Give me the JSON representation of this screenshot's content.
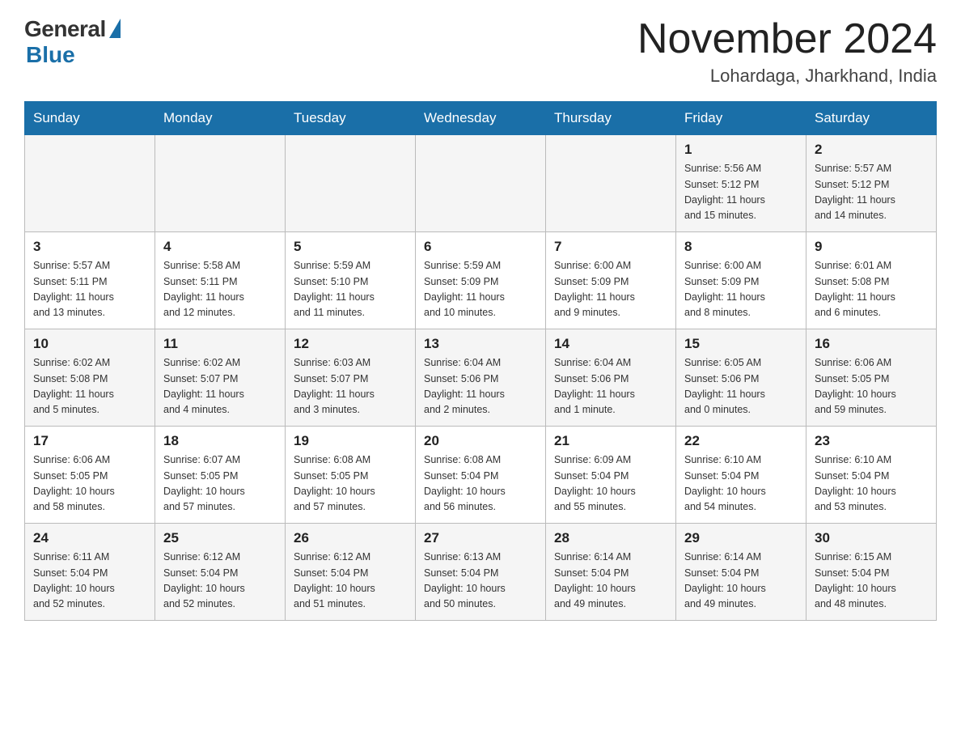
{
  "header": {
    "logo_general": "General",
    "logo_blue": "Blue",
    "month_title": "November 2024",
    "location": "Lohardaga, Jharkhand, India"
  },
  "weekdays": [
    "Sunday",
    "Monday",
    "Tuesday",
    "Wednesday",
    "Thursday",
    "Friday",
    "Saturday"
  ],
  "weeks": [
    [
      {
        "day": "",
        "info": ""
      },
      {
        "day": "",
        "info": ""
      },
      {
        "day": "",
        "info": ""
      },
      {
        "day": "",
        "info": ""
      },
      {
        "day": "",
        "info": ""
      },
      {
        "day": "1",
        "info": "Sunrise: 5:56 AM\nSunset: 5:12 PM\nDaylight: 11 hours\nand 15 minutes."
      },
      {
        "day": "2",
        "info": "Sunrise: 5:57 AM\nSunset: 5:12 PM\nDaylight: 11 hours\nand 14 minutes."
      }
    ],
    [
      {
        "day": "3",
        "info": "Sunrise: 5:57 AM\nSunset: 5:11 PM\nDaylight: 11 hours\nand 13 minutes."
      },
      {
        "day": "4",
        "info": "Sunrise: 5:58 AM\nSunset: 5:11 PM\nDaylight: 11 hours\nand 12 minutes."
      },
      {
        "day": "5",
        "info": "Sunrise: 5:59 AM\nSunset: 5:10 PM\nDaylight: 11 hours\nand 11 minutes."
      },
      {
        "day": "6",
        "info": "Sunrise: 5:59 AM\nSunset: 5:09 PM\nDaylight: 11 hours\nand 10 minutes."
      },
      {
        "day": "7",
        "info": "Sunrise: 6:00 AM\nSunset: 5:09 PM\nDaylight: 11 hours\nand 9 minutes."
      },
      {
        "day": "8",
        "info": "Sunrise: 6:00 AM\nSunset: 5:09 PM\nDaylight: 11 hours\nand 8 minutes."
      },
      {
        "day": "9",
        "info": "Sunrise: 6:01 AM\nSunset: 5:08 PM\nDaylight: 11 hours\nand 6 minutes."
      }
    ],
    [
      {
        "day": "10",
        "info": "Sunrise: 6:02 AM\nSunset: 5:08 PM\nDaylight: 11 hours\nand 5 minutes."
      },
      {
        "day": "11",
        "info": "Sunrise: 6:02 AM\nSunset: 5:07 PM\nDaylight: 11 hours\nand 4 minutes."
      },
      {
        "day": "12",
        "info": "Sunrise: 6:03 AM\nSunset: 5:07 PM\nDaylight: 11 hours\nand 3 minutes."
      },
      {
        "day": "13",
        "info": "Sunrise: 6:04 AM\nSunset: 5:06 PM\nDaylight: 11 hours\nand 2 minutes."
      },
      {
        "day": "14",
        "info": "Sunrise: 6:04 AM\nSunset: 5:06 PM\nDaylight: 11 hours\nand 1 minute."
      },
      {
        "day": "15",
        "info": "Sunrise: 6:05 AM\nSunset: 5:06 PM\nDaylight: 11 hours\nand 0 minutes."
      },
      {
        "day": "16",
        "info": "Sunrise: 6:06 AM\nSunset: 5:05 PM\nDaylight: 10 hours\nand 59 minutes."
      }
    ],
    [
      {
        "day": "17",
        "info": "Sunrise: 6:06 AM\nSunset: 5:05 PM\nDaylight: 10 hours\nand 58 minutes."
      },
      {
        "day": "18",
        "info": "Sunrise: 6:07 AM\nSunset: 5:05 PM\nDaylight: 10 hours\nand 57 minutes."
      },
      {
        "day": "19",
        "info": "Sunrise: 6:08 AM\nSunset: 5:05 PM\nDaylight: 10 hours\nand 57 minutes."
      },
      {
        "day": "20",
        "info": "Sunrise: 6:08 AM\nSunset: 5:04 PM\nDaylight: 10 hours\nand 56 minutes."
      },
      {
        "day": "21",
        "info": "Sunrise: 6:09 AM\nSunset: 5:04 PM\nDaylight: 10 hours\nand 55 minutes."
      },
      {
        "day": "22",
        "info": "Sunrise: 6:10 AM\nSunset: 5:04 PM\nDaylight: 10 hours\nand 54 minutes."
      },
      {
        "day": "23",
        "info": "Sunrise: 6:10 AM\nSunset: 5:04 PM\nDaylight: 10 hours\nand 53 minutes."
      }
    ],
    [
      {
        "day": "24",
        "info": "Sunrise: 6:11 AM\nSunset: 5:04 PM\nDaylight: 10 hours\nand 52 minutes."
      },
      {
        "day": "25",
        "info": "Sunrise: 6:12 AM\nSunset: 5:04 PM\nDaylight: 10 hours\nand 52 minutes."
      },
      {
        "day": "26",
        "info": "Sunrise: 6:12 AM\nSunset: 5:04 PM\nDaylight: 10 hours\nand 51 minutes."
      },
      {
        "day": "27",
        "info": "Sunrise: 6:13 AM\nSunset: 5:04 PM\nDaylight: 10 hours\nand 50 minutes."
      },
      {
        "day": "28",
        "info": "Sunrise: 6:14 AM\nSunset: 5:04 PM\nDaylight: 10 hours\nand 49 minutes."
      },
      {
        "day": "29",
        "info": "Sunrise: 6:14 AM\nSunset: 5:04 PM\nDaylight: 10 hours\nand 49 minutes."
      },
      {
        "day": "30",
        "info": "Sunrise: 6:15 AM\nSunset: 5:04 PM\nDaylight: 10 hours\nand 48 minutes."
      }
    ]
  ]
}
